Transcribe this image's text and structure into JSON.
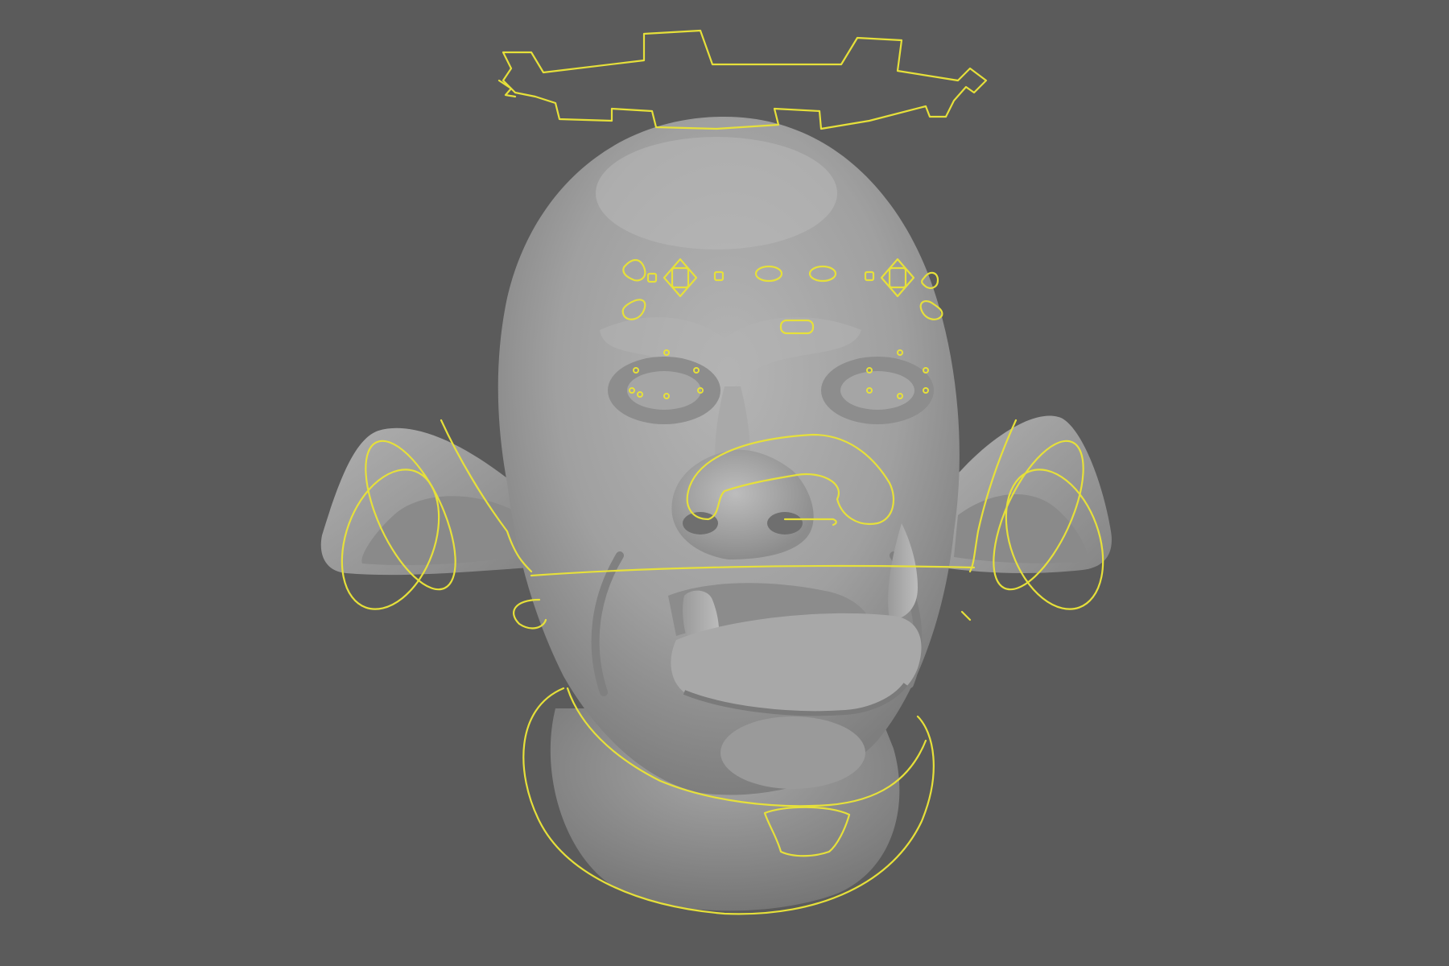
{
  "viewport": {
    "background_color": "#5b5b5b",
    "mesh_color": "#a3a3a3",
    "mesh_shadow_color": "#6f6f6f",
    "mesh_highlight_color": "#c4c4c4",
    "controller_color": "#e6e03a"
  },
  "model": {
    "icon": "creature-head-mesh"
  },
  "rig_controls": [
    "head-crown-control",
    "brow-controls",
    "eye-controls",
    "nose-control",
    "ear-controls",
    "jaw-control",
    "neck-control",
    "chin-control"
  ]
}
